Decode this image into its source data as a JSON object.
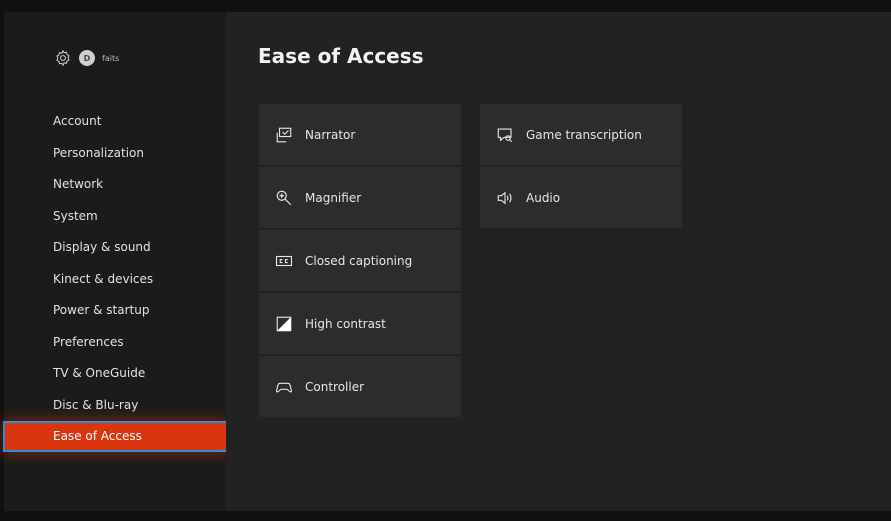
{
  "profile": {
    "avatar_initial": "D",
    "gamertag": "faits"
  },
  "sidebar": {
    "items": [
      {
        "label": "Account"
      },
      {
        "label": "Personalization"
      },
      {
        "label": "Network"
      },
      {
        "label": "System"
      },
      {
        "label": "Display & sound"
      },
      {
        "label": "Kinect & devices"
      },
      {
        "label": "Power & startup"
      },
      {
        "label": "Preferences"
      },
      {
        "label": "TV & OneGuide"
      },
      {
        "label": "Disc & Blu-ray"
      },
      {
        "label": "Ease of Access",
        "selected": true
      }
    ]
  },
  "main": {
    "title": "Ease of Access",
    "tiles_left": [
      {
        "label": "Narrator",
        "icon": "narrator-icon"
      },
      {
        "label": "Magnifier",
        "icon": "magnifier-icon"
      },
      {
        "label": "Closed captioning",
        "icon": "closed-captioning-icon"
      },
      {
        "label": "High contrast",
        "icon": "high-contrast-icon"
      },
      {
        "label": "Controller",
        "icon": "controller-icon"
      }
    ],
    "tiles_right": [
      {
        "label": "Game transcription",
        "icon": "game-transcription-icon"
      },
      {
        "label": "Audio",
        "icon": "speaker-icon"
      }
    ]
  },
  "colors": {
    "accent": "#d9350f",
    "focus_outline": "#2a8fd8",
    "tile_bg": "#2c2c2c",
    "sidebar_bg": "#1b1b1b",
    "main_bg": "#222222"
  }
}
